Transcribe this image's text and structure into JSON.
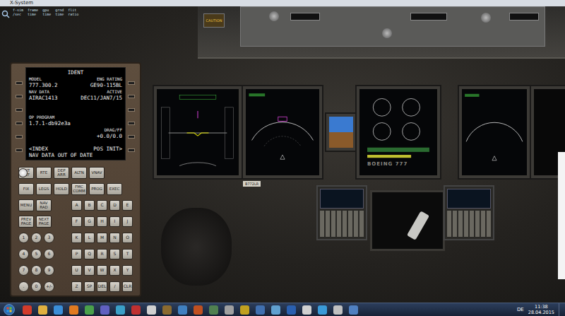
{
  "window": {
    "title": "X-System"
  },
  "overlay": {
    "lines": [
      "f-sim  frame  gpu   grnd  flit",
      "/sec   time   time  time  ratio"
    ]
  },
  "cockpit": {
    "caution": "CAUTION",
    "brand": "BOEING 777",
    "placard": "B772LR"
  },
  "cdu": {
    "title": "IDENT",
    "rows": [
      {
        "left": "MODEL",
        "right": "ENG RATING",
        "kind": "label"
      },
      {
        "left": "777.300.2",
        "right": "GE90-115BL",
        "kind": "value"
      },
      {
        "left": "NAV DATA",
        "right": "ACTIVE",
        "kind": "label"
      },
      {
        "left": "AIRAC1413",
        "right": "DEC11/JAN7/15",
        "kind": "value"
      },
      {
        "left": "",
        "right": "",
        "kind": "label"
      },
      {
        "left": "",
        "right": "",
        "kind": "value"
      },
      {
        "left": "OP PROGRAM",
        "right": "",
        "kind": "label"
      },
      {
        "left": "1.7.1-db92e3a",
        "right": "",
        "kind": "value"
      },
      {
        "left": "",
        "right": "DRAG/FF",
        "kind": "label"
      },
      {
        "left": "",
        "right": "+0.0/0.0",
        "kind": "value"
      },
      {
        "left": "",
        "right": "",
        "kind": "label"
      },
      {
        "left": "<INDEX",
        "right": "POS INIT>",
        "kind": "value"
      }
    ],
    "scratchpad": "NAV DATA OUT OF DATE",
    "keys": [
      {
        "left": [
          {
            "label": "INIT REF",
            "kind": "fn"
          },
          {
            "label": "RTE",
            "kind": "fn"
          },
          {
            "label": "DEP ARR",
            "kind": "fn"
          },
          {
            "label": "ALTN",
            "kind": "fn"
          },
          {
            "label": "VNAV",
            "kind": "fn"
          },
          {
            "label": "",
            "kind": "knob"
          }
        ],
        "right": []
      },
      {
        "left": [
          {
            "label": "FIX",
            "kind": "fn"
          },
          {
            "label": "LEGS",
            "kind": "fn"
          },
          {
            "label": "HOLD",
            "kind": "fn"
          },
          {
            "label": "FMC COMM",
            "kind": "fn"
          },
          {
            "label": "PROG",
            "kind": "fn"
          },
          {
            "label": "EXEC",
            "kind": "fn"
          }
        ],
        "right": []
      },
      {
        "left": [
          {
            "label": "MENU",
            "kind": "fn"
          },
          {
            "label": "NAV RAD",
            "kind": "fn"
          }
        ],
        "right": [
          {
            "label": "A",
            "kind": "alpha"
          },
          {
            "label": "B",
            "kind": "alpha"
          },
          {
            "label": "C",
            "kind": "alpha"
          },
          {
            "label": "D",
            "kind": "alpha"
          },
          {
            "label": "E",
            "kind": "alpha"
          }
        ]
      },
      {
        "left": [
          {
            "label": "PREV PAGE",
            "kind": "fn"
          },
          {
            "label": "NEXT PAGE",
            "kind": "fn"
          }
        ],
        "right": [
          {
            "label": "F",
            "kind": "alpha"
          },
          {
            "label": "G",
            "kind": "alpha"
          },
          {
            "label": "H",
            "kind": "alpha"
          },
          {
            "label": "I",
            "kind": "alpha"
          },
          {
            "label": "J",
            "kind": "alpha"
          }
        ]
      },
      {
        "left": [
          {
            "label": "1",
            "kind": "num"
          },
          {
            "label": "2",
            "kind": "num"
          },
          {
            "label": "3",
            "kind": "num"
          }
        ],
        "right": [
          {
            "label": "K",
            "kind": "alpha"
          },
          {
            "label": "L",
            "kind": "alpha"
          },
          {
            "label": "M",
            "kind": "alpha"
          },
          {
            "label": "N",
            "kind": "alpha"
          },
          {
            "label": "O",
            "kind": "alpha"
          }
        ]
      },
      {
        "left": [
          {
            "label": "4",
            "kind": "num"
          },
          {
            "label": "5",
            "kind": "num"
          },
          {
            "label": "6",
            "kind": "num"
          }
        ],
        "right": [
          {
            "label": "P",
            "kind": "alpha"
          },
          {
            "label": "Q",
            "kind": "alpha"
          },
          {
            "label": "R",
            "kind": "alpha"
          },
          {
            "label": "S",
            "kind": "alpha"
          },
          {
            "label": "T",
            "kind": "alpha"
          }
        ]
      },
      {
        "left": [
          {
            "label": "7",
            "kind": "num"
          },
          {
            "label": "8",
            "kind": "num"
          },
          {
            "label": "9",
            "kind": "num"
          }
        ],
        "right": [
          {
            "label": "U",
            "kind": "alpha"
          },
          {
            "label": "V",
            "kind": "alpha"
          },
          {
            "label": "W",
            "kind": "alpha"
          },
          {
            "label": "X",
            "kind": "alpha"
          },
          {
            "label": "Y",
            "kind": "alpha"
          }
        ]
      },
      {
        "left": [
          {
            "label": ".",
            "kind": "num"
          },
          {
            "label": "0",
            "kind": "num"
          },
          {
            "label": "+/-",
            "kind": "num"
          }
        ],
        "right": [
          {
            "label": "Z",
            "kind": "alpha"
          },
          {
            "label": "SP",
            "kind": "alpha"
          },
          {
            "label": "DEL",
            "kind": "alpha"
          },
          {
            "label": "/",
            "kind": "alpha"
          },
          {
            "label": "CLR",
            "kind": "alpha"
          }
        ]
      }
    ]
  },
  "taskbar": {
    "lang": "DE",
    "time": "11:38",
    "date": "28.04.2015"
  }
}
